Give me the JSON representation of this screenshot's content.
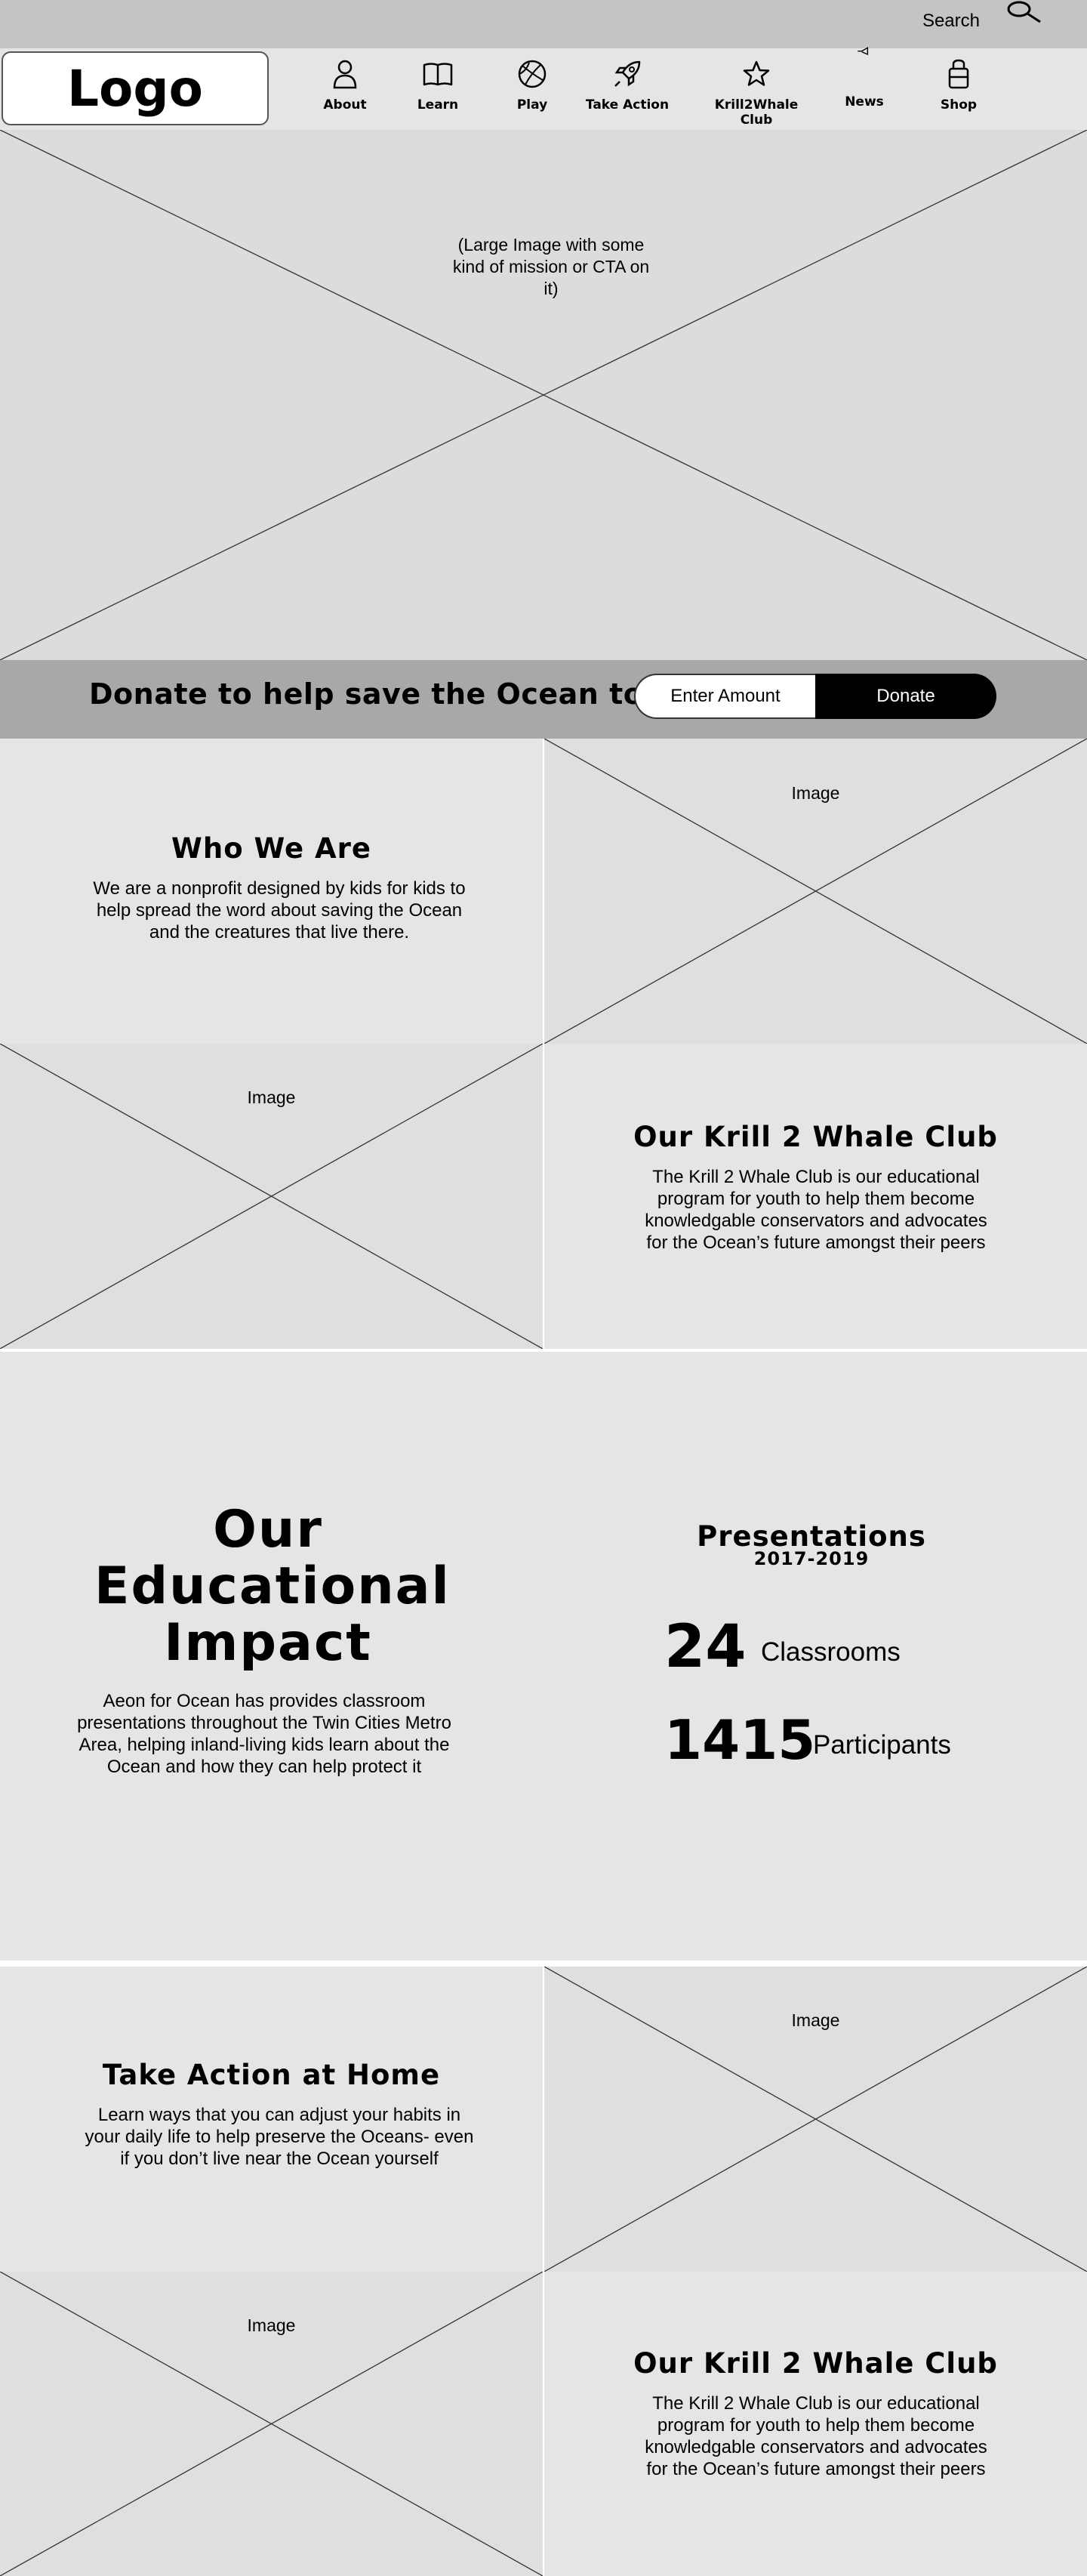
{
  "header": {
    "search_label": "Search",
    "logo_text": "Logo",
    "nav": [
      {
        "label": "About",
        "icon": "user-icon"
      },
      {
        "label": "Learn",
        "icon": "book-icon"
      },
      {
        "label": "Play",
        "icon": "ball-icon"
      },
      {
        "label": "Take Action",
        "icon": "rocket-icon"
      },
      {
        "label": "Krill2Whale Club",
        "icon": "star-icon"
      },
      {
        "label": "News",
        "icon": "megaphone-icon"
      },
      {
        "label": "Shop",
        "icon": "shopping-bag-icon"
      }
    ]
  },
  "hero": {
    "caption": "(Large Image with some kind of mission or CTA on it)"
  },
  "donate": {
    "text": "Donate to help save the Ocean today!",
    "amount_placeholder": "Enter Amount",
    "button_label": "Donate"
  },
  "who_we_are": {
    "title": "Who We Are",
    "body": "We are a nonprofit designed by kids for kids to help spread the word about saving the Ocean and the creatures that live there.",
    "image_label": "Image"
  },
  "krill_club_1": {
    "image_label": "Image",
    "title": "Our Krill 2 Whale Club",
    "body": "The Krill 2 Whale Club is our educational program for youth to help them become knowledgable conservators and advocates for the Ocean’s future amongst their peers"
  },
  "impact": {
    "title": "Our Educational Impact",
    "body": "Aeon for Ocean has provides classroom presentations throughout the Twin Cities Metro Area, helping inland-living kids learn about the Ocean and how they can help protect it",
    "presentations_title": "Presentations",
    "presentations_years": "2017-2019",
    "stats": [
      {
        "value": "24",
        "label": "Classrooms"
      },
      {
        "value": "1415",
        "label": "Participants"
      }
    ]
  },
  "take_action": {
    "title": "Take Action at Home",
    "body": "Learn ways that you can adjust your habits in your daily life to help preserve the Oceans- even if you don’t live near the Ocean yourself",
    "image_label": "Image"
  },
  "krill_club_2": {
    "image_label": "Image",
    "title": "Our Krill 2 Whale Club",
    "body": "The Krill 2 Whale Club is our educational program for youth to help them become knowledgable conservators and advocates for the Ocean’s future amongst their peers"
  }
}
